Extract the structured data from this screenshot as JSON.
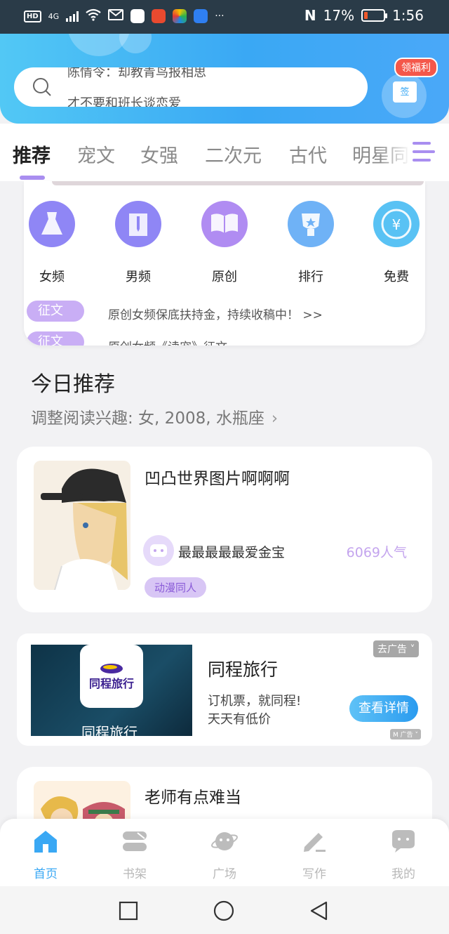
{
  "status_bar": {
    "hd": "HD",
    "network": "4G",
    "battery_pct": "17%",
    "time": "1:56",
    "more": "···"
  },
  "search": {
    "lines": [
      "陈情令：却教青鸟报相思",
      "才不要和班长谈恋爱"
    ]
  },
  "gift": {
    "tag": "领福利",
    "box": "签"
  },
  "tabs": [
    "推荐",
    "宠文",
    "女强",
    "二次元",
    "古代",
    "明星同"
  ],
  "categories": [
    {
      "label": "女频",
      "icon": "dress-icon",
      "color": "#8f86f5"
    },
    {
      "label": "男频",
      "icon": "shirt-icon",
      "color": "#8f86f5"
    },
    {
      "label": "原创",
      "icon": "book-icon",
      "color": "#b08cf2"
    },
    {
      "label": "排行",
      "icon": "trophy-icon",
      "color": "#6fb2f6"
    },
    {
      "label": "免费",
      "icon": "yuan-icon",
      "color": "#59c2f4"
    }
  ],
  "notices": [
    {
      "pill": "征文",
      "text": "原创女频保底扶持金，持续收稿中！ >>"
    },
    {
      "pill": "征文",
      "text": "原创女频《读宠》征文"
    }
  ],
  "today": {
    "title": "今日推荐",
    "subtitle": "调整阅读兴趣: 女, 2008, 水瓶座"
  },
  "books": [
    {
      "title": "凹凸世界图片啊啊啊",
      "author": "最最最最最爱金宝",
      "popularity": "6069人气",
      "tag": "动漫同人"
    },
    {
      "title": "老师有点难当"
    }
  ],
  "ad": {
    "brand": "同程旅行",
    "title": "同程旅行",
    "desc_line1": "订机票，就同程!",
    "desc_line2": "天天有低价",
    "button": "查看详情",
    "close": "去广告",
    "mark": "广告",
    "caption": "同程旅行"
  },
  "bottom_nav": [
    {
      "label": "首页",
      "icon": "home-icon",
      "active": true
    },
    {
      "label": "书架",
      "icon": "bookshelf-icon"
    },
    {
      "label": "广场",
      "icon": "planet-icon"
    },
    {
      "label": "写作",
      "icon": "pen-icon"
    },
    {
      "label": "我的",
      "icon": "chat-icon"
    }
  ],
  "colors": {
    "accent_blue": "#3aa8f4",
    "accent_purple": "#a98ef0",
    "popularity": "#c4a5ee"
  }
}
